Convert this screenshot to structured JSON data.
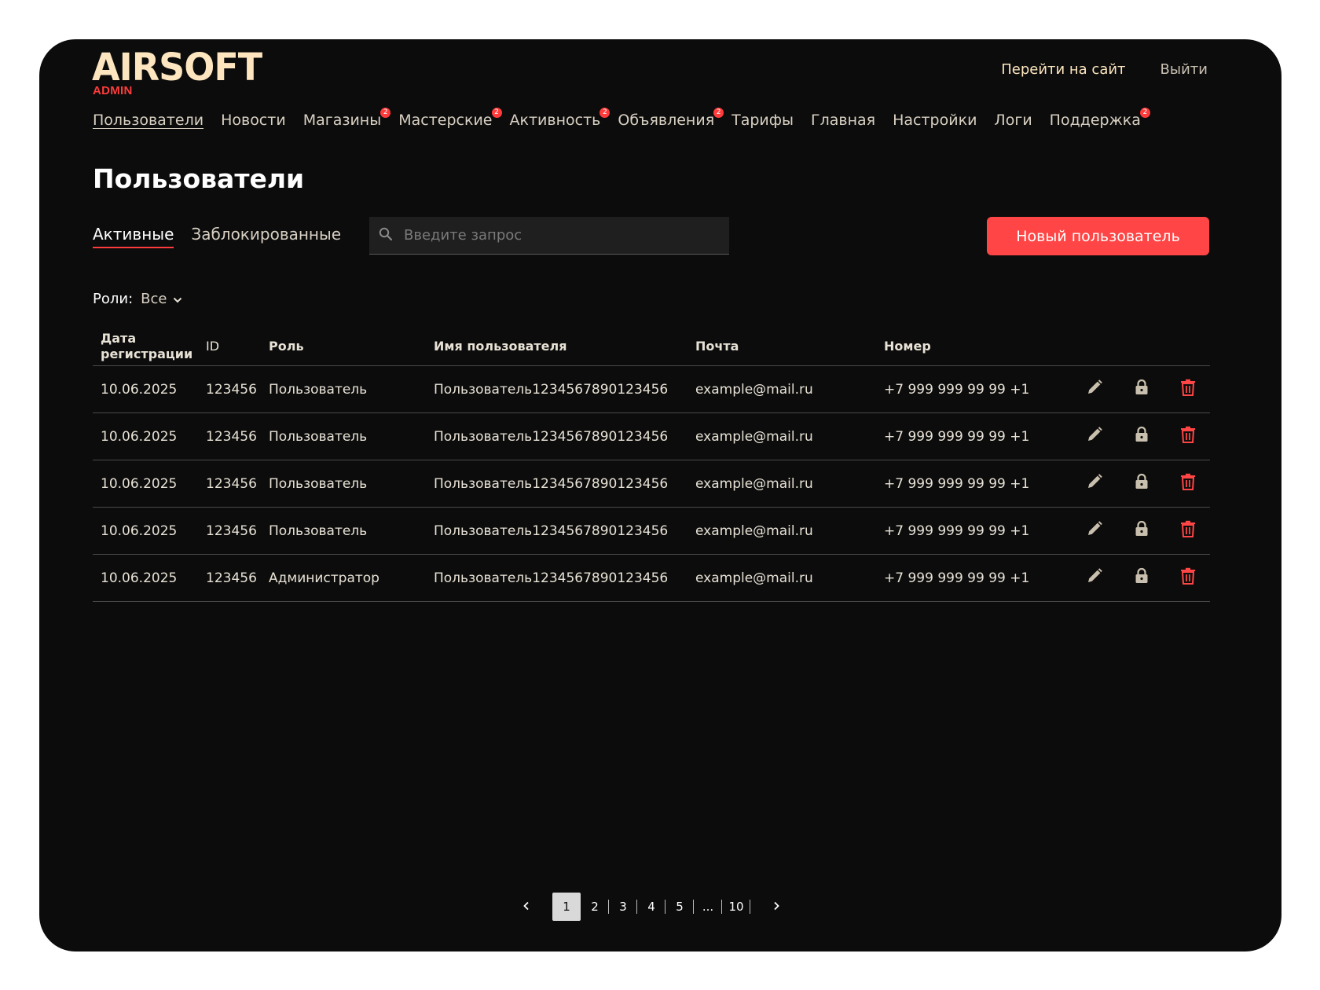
{
  "header": {
    "logo_text": "AIRSOFT",
    "logo_sub": "ADMIN",
    "goto_site": "Перейти на сайт",
    "logout": "Выйти"
  },
  "nav": [
    {
      "label": "Пользователи",
      "active": true,
      "badge": null
    },
    {
      "label": "Новости",
      "badge": null
    },
    {
      "label": "Магазины",
      "badge": "2"
    },
    {
      "label": "Мастерские",
      "badge": "2"
    },
    {
      "label": "Активность",
      "badge": "2"
    },
    {
      "label": "Объявления",
      "badge": "2"
    },
    {
      "label": "Тарифы",
      "badge": null
    },
    {
      "label": "Главная",
      "badge": null
    },
    {
      "label": "Настройки",
      "badge": null
    },
    {
      "label": "Логи",
      "badge": null
    },
    {
      "label": "Поддержка",
      "badge": "2"
    }
  ],
  "page_title": "Пользователи",
  "tabs": [
    "Активные",
    "Заблокированные"
  ],
  "search": {
    "placeholder": "Введите запрос"
  },
  "new_user_button": "Новый пользователь",
  "roles_filter": {
    "label": "Роли:",
    "value": "Все"
  },
  "table": {
    "headers": [
      "Дата регистрации",
      "ID",
      "Роль",
      "Имя пользователя",
      "Почта",
      "Номер"
    ],
    "rows": [
      [
        "10.06.2025",
        "123456",
        "Пользователь",
        "Пользователь1234567890123456",
        "example@mail.ru",
        "+7 999 999 99 99 +1"
      ],
      [
        "10.06.2025",
        "123456",
        "Пользователь",
        "Пользователь1234567890123456",
        "example@mail.ru",
        "+7 999 999 99 99 +1"
      ],
      [
        "10.06.2025",
        "123456",
        "Пользователь",
        "Пользователь1234567890123456",
        "example@mail.ru",
        "+7 999 999 99 99 +1"
      ],
      [
        "10.06.2025",
        "123456",
        "Пользователь",
        "Пользователь1234567890123456",
        "example@mail.ru",
        "+7 999 999 99 99 +1"
      ],
      [
        "10.06.2025",
        "123456",
        "Администратор",
        "Пользователь1234567890123456",
        "example@mail.ru",
        "+7 999 999 99 99 +1"
      ]
    ],
    "row_actions": [
      "edit-icon",
      "lock-icon",
      "trash-icon"
    ]
  },
  "pagination": {
    "prev_icon": "chevron-left-icon",
    "next_icon": "chevron-right-icon",
    "pages": [
      "1",
      "2",
      "3",
      "4",
      "5",
      "...",
      "10"
    ],
    "current": "1"
  },
  "colors": {
    "background": "#0c0c0c",
    "accent": "#ff4545",
    "logo": "#fde6bf",
    "text": "#e8e2d6"
  }
}
